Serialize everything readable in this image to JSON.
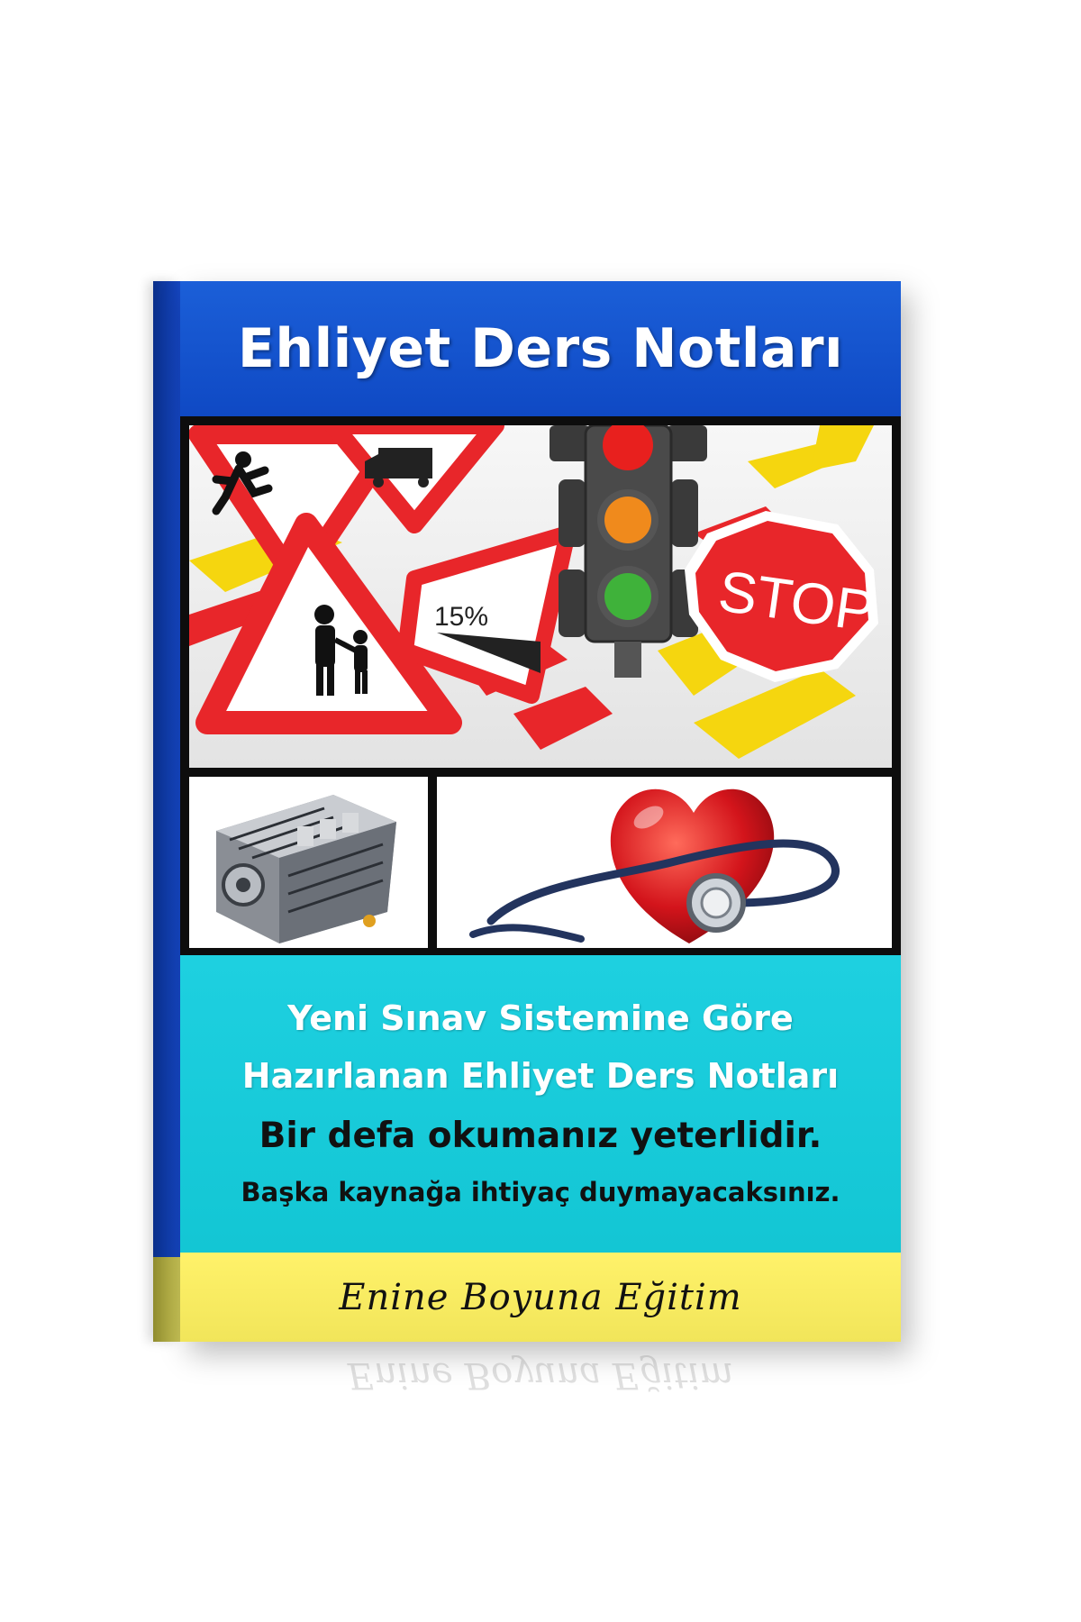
{
  "cover": {
    "title": "Ehliyet Ders Notları",
    "tagline_1": "Yeni Sınav Sistemine Göre",
    "tagline_2": "Hazırlanan Ehliyet Ders Notları",
    "tagline_3": "Bir defa okumanız yeterlidir.",
    "tagline_4": "Başka kaynağa ihtiyaç duymayacaksınız.",
    "brand": "Enine Boyuna Eğitim",
    "sign_stop_text": "STOP",
    "sign_grade_text": "15%"
  },
  "colors": {
    "title_band": "#1b5fd8",
    "teal_band": "#13c6d4",
    "yellow_band": "#f1e55a",
    "sign_red": "#e8262a",
    "sign_yellow": "#f5d60f"
  },
  "icons": [
    "traffic-light-icon",
    "stop-sign-icon",
    "pedestrian-sign-icon",
    "truck-sign-icon",
    "engine-image",
    "heart-stethoscope-image"
  ]
}
